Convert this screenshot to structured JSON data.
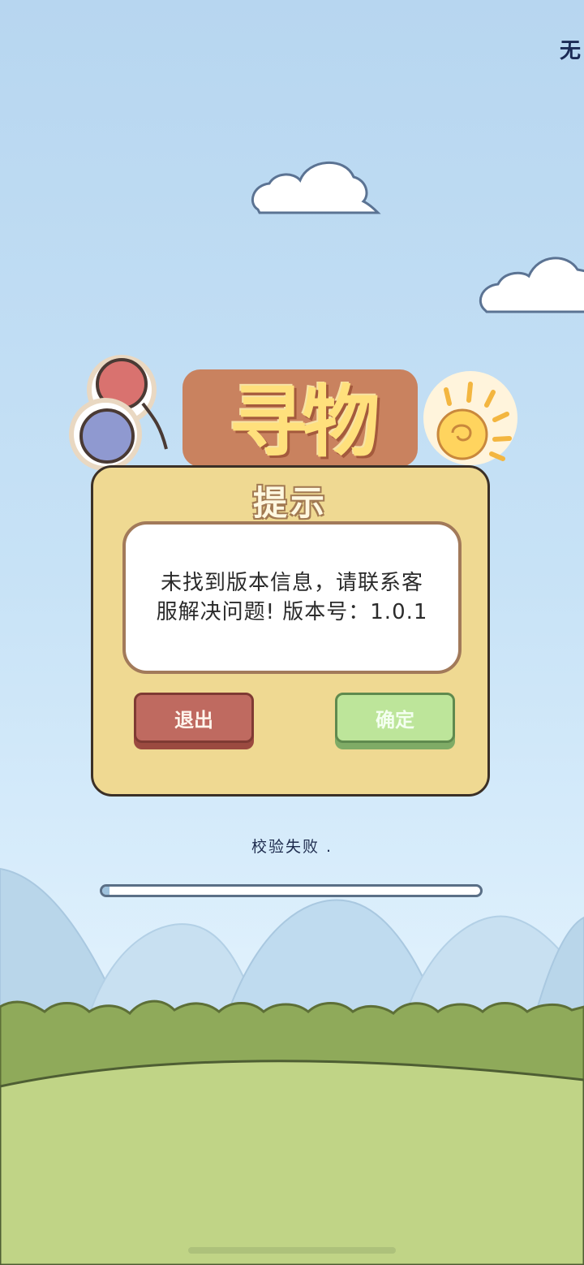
{
  "status_bar": {
    "corner_text": "无"
  },
  "logo": {
    "title": "寻物"
  },
  "dialog": {
    "title": "提示",
    "message": "未找到版本信息，请联系客服解决问题! 版本号：1.0.1",
    "exit_label": "退出",
    "confirm_label": "确定"
  },
  "loading": {
    "status_text": "校验失败 .",
    "progress": 0.02
  },
  "colors": {
    "sky": "#c7e2f6",
    "dialog_bg": "#efd992",
    "exit_button": "#bf6a60",
    "confirm_button": "#bde59a",
    "grass": "#c0d486"
  }
}
